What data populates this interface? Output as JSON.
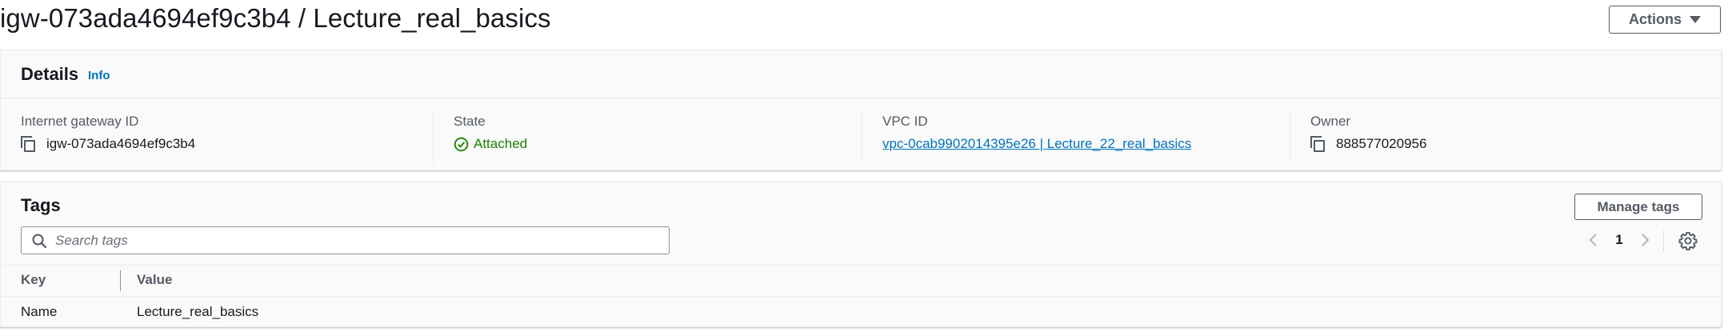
{
  "header": {
    "title": "igw-073ada4694ef9c3b4 / Lecture_real_basics",
    "actions_label": "Actions"
  },
  "details": {
    "title": "Details",
    "info_label": "Info",
    "fields": {
      "gateway_id": {
        "label": "Internet gateway ID",
        "value": "igw-073ada4694ef9c3b4"
      },
      "state": {
        "label": "State",
        "value": "Attached"
      },
      "vpc_id": {
        "label": "VPC ID",
        "value": "vpc-0cab9902014395e26 | Lecture_22_real_basics"
      },
      "owner": {
        "label": "Owner",
        "value": "888577020956"
      }
    }
  },
  "tags": {
    "title": "Tags",
    "manage_label": "Manage tags",
    "search_placeholder": "Search tags",
    "page": "1",
    "columns": {
      "key": "Key",
      "value": "Value"
    },
    "rows": [
      {
        "key": "Name",
        "value": "Lecture_real_basics"
      }
    ]
  },
  "colors": {
    "link": "#0073bb",
    "success": "#1d8102",
    "text": "#16191f",
    "muted": "#545b64"
  }
}
